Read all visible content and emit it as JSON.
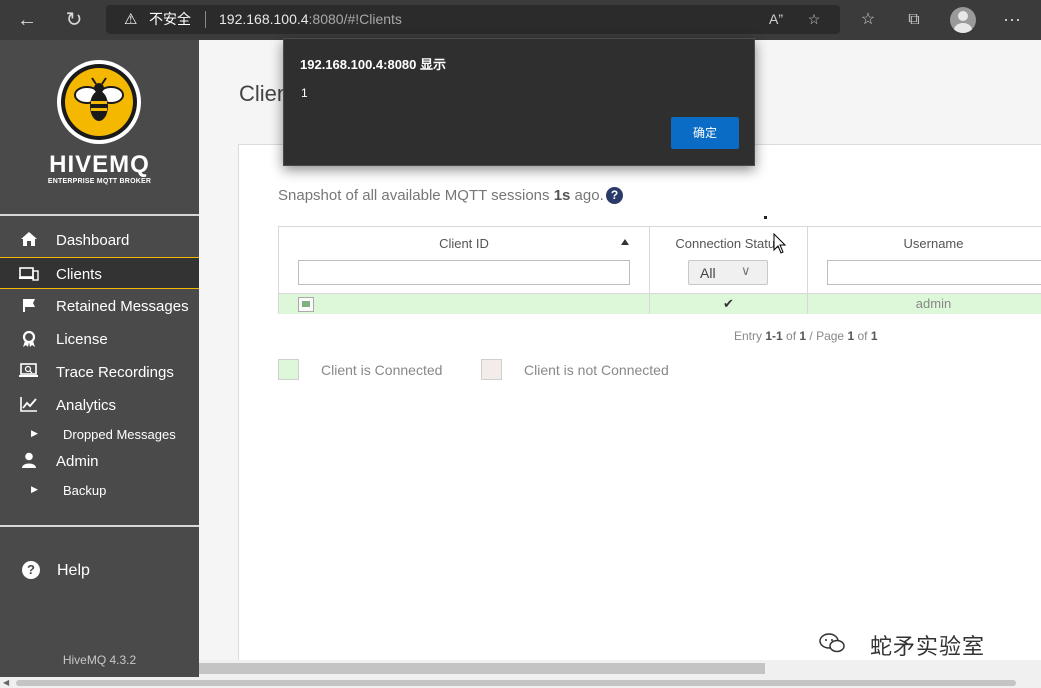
{
  "browser": {
    "warning_icon": "warning-triangle-icon",
    "insecure_label": "不安全",
    "url_host": "192.168.100.4",
    "url_rest": ":8080/#!Clients"
  },
  "sidebar": {
    "logo_title": "HIVEMQ",
    "logo_subtitle": "ENTERPRISE MQTT BROKER",
    "items": [
      {
        "label": "Dashboard",
        "icon": "home-icon"
      },
      {
        "label": "Clients",
        "icon": "clients-icon"
      },
      {
        "label": "Retained Messages",
        "icon": "flag-icon"
      },
      {
        "label": "License",
        "icon": "award-icon"
      },
      {
        "label": "Trace Recordings",
        "icon": "laptop-search-icon"
      },
      {
        "label": "Analytics",
        "icon": "chart-line-icon"
      },
      {
        "label": "Dropped Messages",
        "icon": "caret-right-icon"
      },
      {
        "label": "Admin",
        "icon": "user-icon"
      },
      {
        "label": "Backup",
        "icon": "caret-right-icon"
      }
    ],
    "help_label": "Help",
    "help_icon_glyph": "?",
    "version": "HiveMQ 4.3.2"
  },
  "main": {
    "page_title": "Clients",
    "snapshot_prefix": "Snapshot of all available MQTT sessions ",
    "snapshot_age": "1s",
    "snapshot_suffix": " ago.",
    "help_glyph": "?",
    "columns": [
      "Client ID",
      "Connection Status",
      "Username"
    ],
    "status_filter": "All",
    "rows": [
      {
        "client_id": "",
        "status": "✔",
        "username": "admin"
      }
    ],
    "pager": {
      "prefix": "Entry ",
      "range": "1-1",
      "of1": " of ",
      "total": "1",
      "page_label": " / Page ",
      "page": "1",
      "of2": " of ",
      "pages": "1"
    },
    "legend": [
      {
        "label": "Client is Connected",
        "color": "#ddf8d8"
      },
      {
        "label": "Client is not Connected",
        "color": "#f3ece8"
      }
    ]
  },
  "dialog": {
    "title": "192.168.100.4:8080 显示",
    "message": "1",
    "ok_label": "确定"
  },
  "watermark": {
    "label": "蛇矛实验室"
  },
  "colors": {
    "accent": "#f5b800",
    "sidebar_bg": "#4a4a4a",
    "dialog_button": "#0a6cc4",
    "connected_row": "#ddf8d8"
  }
}
